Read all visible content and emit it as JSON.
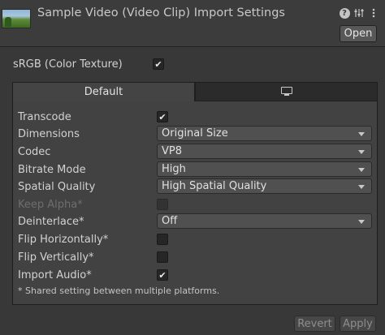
{
  "header": {
    "title": "Sample Video (Video Clip) Import Settings",
    "open_label": "Open",
    "icons": [
      "help-icon",
      "settings-sliders-icon",
      "more-vertical-icon"
    ]
  },
  "srgb": {
    "label": "sRGB (Color Texture)",
    "checked": true
  },
  "tabs": [
    {
      "label": "Default",
      "active": true
    },
    {
      "icon": "monitor-icon",
      "active": false
    }
  ],
  "settings": {
    "transcode": {
      "label": "Transcode",
      "checked": true
    },
    "dimensions": {
      "label": "Dimensions",
      "value": "Original Size"
    },
    "codec": {
      "label": "Codec",
      "value": "VP8"
    },
    "bitrate_mode": {
      "label": "Bitrate Mode",
      "value": "High"
    },
    "spatial_quality": {
      "label": "Spatial Quality",
      "value": "High Spatial Quality"
    },
    "keep_alpha": {
      "label": "Keep Alpha*",
      "checked": false,
      "disabled": true
    },
    "deinterlace": {
      "label": "Deinterlace*",
      "value": "Off"
    },
    "flip_horizontally": {
      "label": "Flip Horizontally*",
      "checked": false
    },
    "flip_vertically": {
      "label": "Flip Vertically*",
      "checked": false
    },
    "import_audio": {
      "label": "Import Audio*",
      "checked": true
    }
  },
  "footnote": "* Shared setting between multiple platforms.",
  "buttons": {
    "revert": "Revert",
    "apply": "Apply"
  },
  "check_glyph": "✔"
}
